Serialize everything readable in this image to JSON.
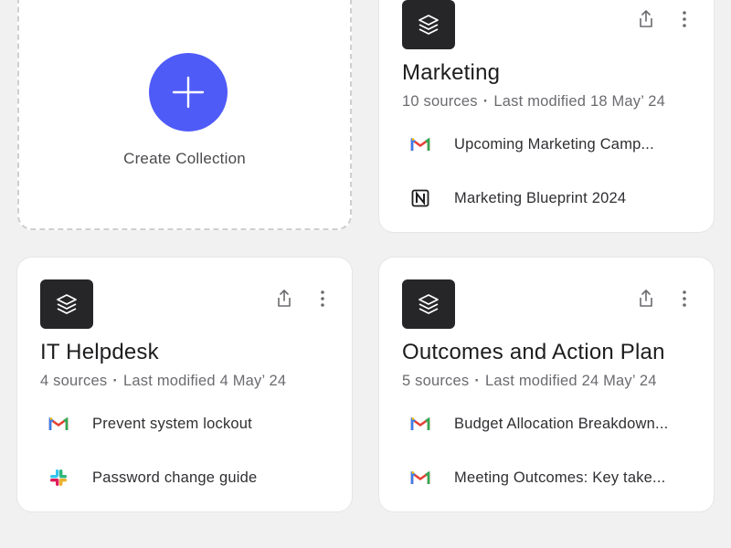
{
  "create": {
    "label": "Create Collection"
  },
  "cards": [
    {
      "title": "Marketing",
      "sources": "10 sources",
      "modified": "Last modified 18 May’ 24",
      "items": [
        {
          "icon": "gmail-icon",
          "text": "Upcoming Marketing Camp..."
        },
        {
          "icon": "notion-icon",
          "text": "Marketing Blueprint 2024"
        }
      ]
    },
    {
      "title": "IT Helpdesk",
      "sources": "4 sources",
      "modified": "Last modified 4 May’ 24",
      "items": [
        {
          "icon": "gmail-icon",
          "text": "Prevent system lockout"
        },
        {
          "icon": "slack-icon",
          "text": "Password change guide"
        }
      ]
    },
    {
      "title": "Outcomes and Action Plan",
      "sources": "5 sources",
      "modified": "Last modified 24 May’ 24",
      "items": [
        {
          "icon": "gmail-icon",
          "text": "Budget Allocation Breakdown..."
        },
        {
          "icon": "gmail-icon",
          "text": "Meeting Outcomes: Key take..."
        }
      ]
    }
  ],
  "colors": {
    "accent": "#4f5bf7",
    "badge": "#262628",
    "background": "#f1f1f2"
  }
}
